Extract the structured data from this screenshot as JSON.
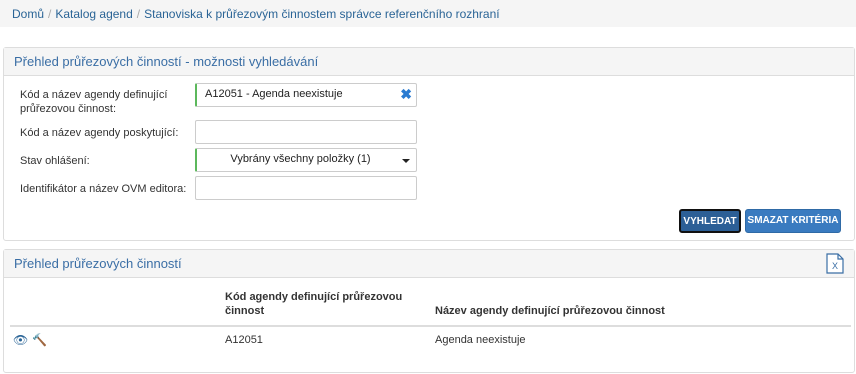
{
  "breadcrumb": {
    "home": "Domů",
    "catalog": "Katalog agend",
    "current": "Stanoviska k průřezovým činnostem správce referenčního rozhraní"
  },
  "search_panel": {
    "title": "Přehled průřezových činností - možnosti vyhledávání",
    "fields": {
      "agenda_code": {
        "label": "Kód a název agendy definující průřezovou činnost:",
        "value": "A12051 - Agenda neexistuje",
        "clear_icon": "close-x-icon"
      },
      "providing_agenda": {
        "label": "Kód a název agendy poskytující:",
        "value": ""
      },
      "status": {
        "label": "Stav ohlášení:",
        "value": "Vybrány všechny položky (1)"
      },
      "ovm_editor": {
        "label": "Identifikátor a název OVM editora:",
        "value": ""
      }
    },
    "buttons": {
      "search": "VYHLEDAT",
      "clear": "SMAZAT KRITÉRIA"
    }
  },
  "results_panel": {
    "title": "Přehled průřezových činností",
    "export_icon": "excel-export-icon",
    "columns": {
      "code": "Kód agendy definující průřezovou činnost",
      "name": "Název agendy definující průřezovou činnost"
    },
    "rows": [
      {
        "code": "A12051",
        "name": "Agenda neexistuje",
        "actions": [
          "eye-icon",
          "gavel-icon"
        ]
      }
    ]
  },
  "colors": {
    "link": "#2a6496",
    "panel_title": "#3a6ea5",
    "button_primary": "#2c5f96",
    "button_secondary": "#3a7bc0",
    "required_marker": "#5cb85c"
  }
}
